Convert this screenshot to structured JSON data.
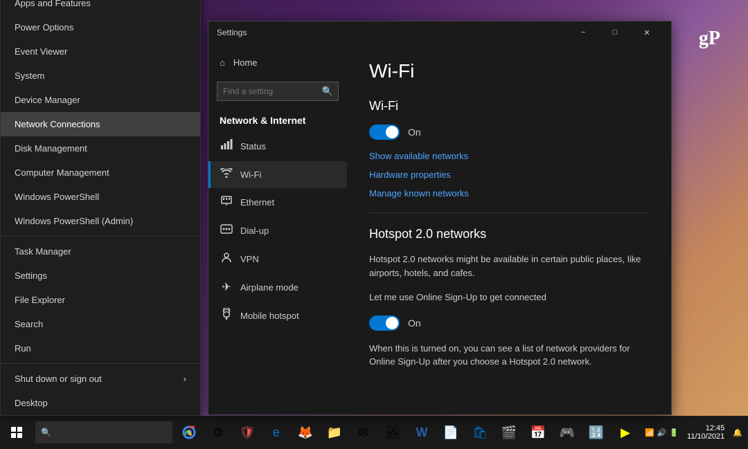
{
  "desktop": {
    "gp_logo": "gP"
  },
  "context_menu": {
    "items": [
      {
        "id": "apps-features",
        "label": "Apps and Features",
        "separator_after": false
      },
      {
        "id": "power-options",
        "label": "Power Options",
        "separator_after": false
      },
      {
        "id": "event-viewer",
        "label": "Event Viewer",
        "separator_after": false
      },
      {
        "id": "system",
        "label": "System",
        "separator_after": false
      },
      {
        "id": "device-manager",
        "label": "Device Manager",
        "separator_after": false
      },
      {
        "id": "network-connections",
        "label": "Network Connections",
        "separator_after": false,
        "active": true
      },
      {
        "id": "disk-management",
        "label": "Disk Management",
        "separator_after": false
      },
      {
        "id": "computer-management",
        "label": "Computer Management",
        "separator_after": false
      },
      {
        "id": "windows-powershell",
        "label": "Windows PowerShell",
        "separator_after": false
      },
      {
        "id": "windows-powershell-admin",
        "label": "Windows PowerShell (Admin)",
        "separator_after": true
      },
      {
        "id": "task-manager",
        "label": "Task Manager",
        "separator_after": false
      },
      {
        "id": "settings",
        "label": "Settings",
        "separator_after": false
      },
      {
        "id": "file-explorer",
        "label": "File Explorer",
        "separator_after": false
      },
      {
        "id": "search",
        "label": "Search",
        "separator_after": false
      },
      {
        "id": "run",
        "label": "Run",
        "separator_after": true
      },
      {
        "id": "shut-down",
        "label": "Shut down or sign out",
        "has_arrow": true,
        "separator_after": false
      },
      {
        "id": "desktop",
        "label": "Desktop",
        "separator_after": false
      }
    ]
  },
  "settings_window": {
    "title": "Settings",
    "minimize": "−",
    "maximize": "□",
    "close": "✕",
    "sidebar": {
      "home_label": "Home",
      "search_placeholder": "Find a setting",
      "section_title": "Network & Internet",
      "nav_items": [
        {
          "id": "status",
          "label": "Status",
          "icon": "📡"
        },
        {
          "id": "wifi",
          "label": "Wi-Fi",
          "icon": "📶",
          "active": true
        },
        {
          "id": "ethernet",
          "label": "Ethernet",
          "icon": "🖧"
        },
        {
          "id": "dialup",
          "label": "Dial-up",
          "icon": "📞"
        },
        {
          "id": "vpn",
          "label": "VPN",
          "icon": "🔒"
        },
        {
          "id": "airplane",
          "label": "Airplane mode",
          "icon": "✈"
        },
        {
          "id": "mobile-hotspot",
          "label": "Mobile hotspot",
          "icon": "📡"
        }
      ]
    },
    "main": {
      "title": "Wi-Fi",
      "wifi_section": {
        "label": "Wi-Fi",
        "toggle_on": true,
        "toggle_label": "On",
        "links": [
          "Show available networks",
          "Hardware properties",
          "Manage known networks"
        ]
      },
      "hotspot_section": {
        "title": "Hotspot 2.0 networks",
        "desc1": "Hotspot 2.0 networks might be available in certain public places, like airports, hotels, and cafes.",
        "desc2": "Let me use Online Sign-Up to get connected",
        "toggle_on": true,
        "toggle_label": "On",
        "desc3": "When this is turned on, you can see a list of network providers for Online Sign-Up after you choose a Hotspot 2.0 network."
      }
    }
  },
  "taskbar": {
    "time": "12:45",
    "date": "11/10/2021"
  }
}
